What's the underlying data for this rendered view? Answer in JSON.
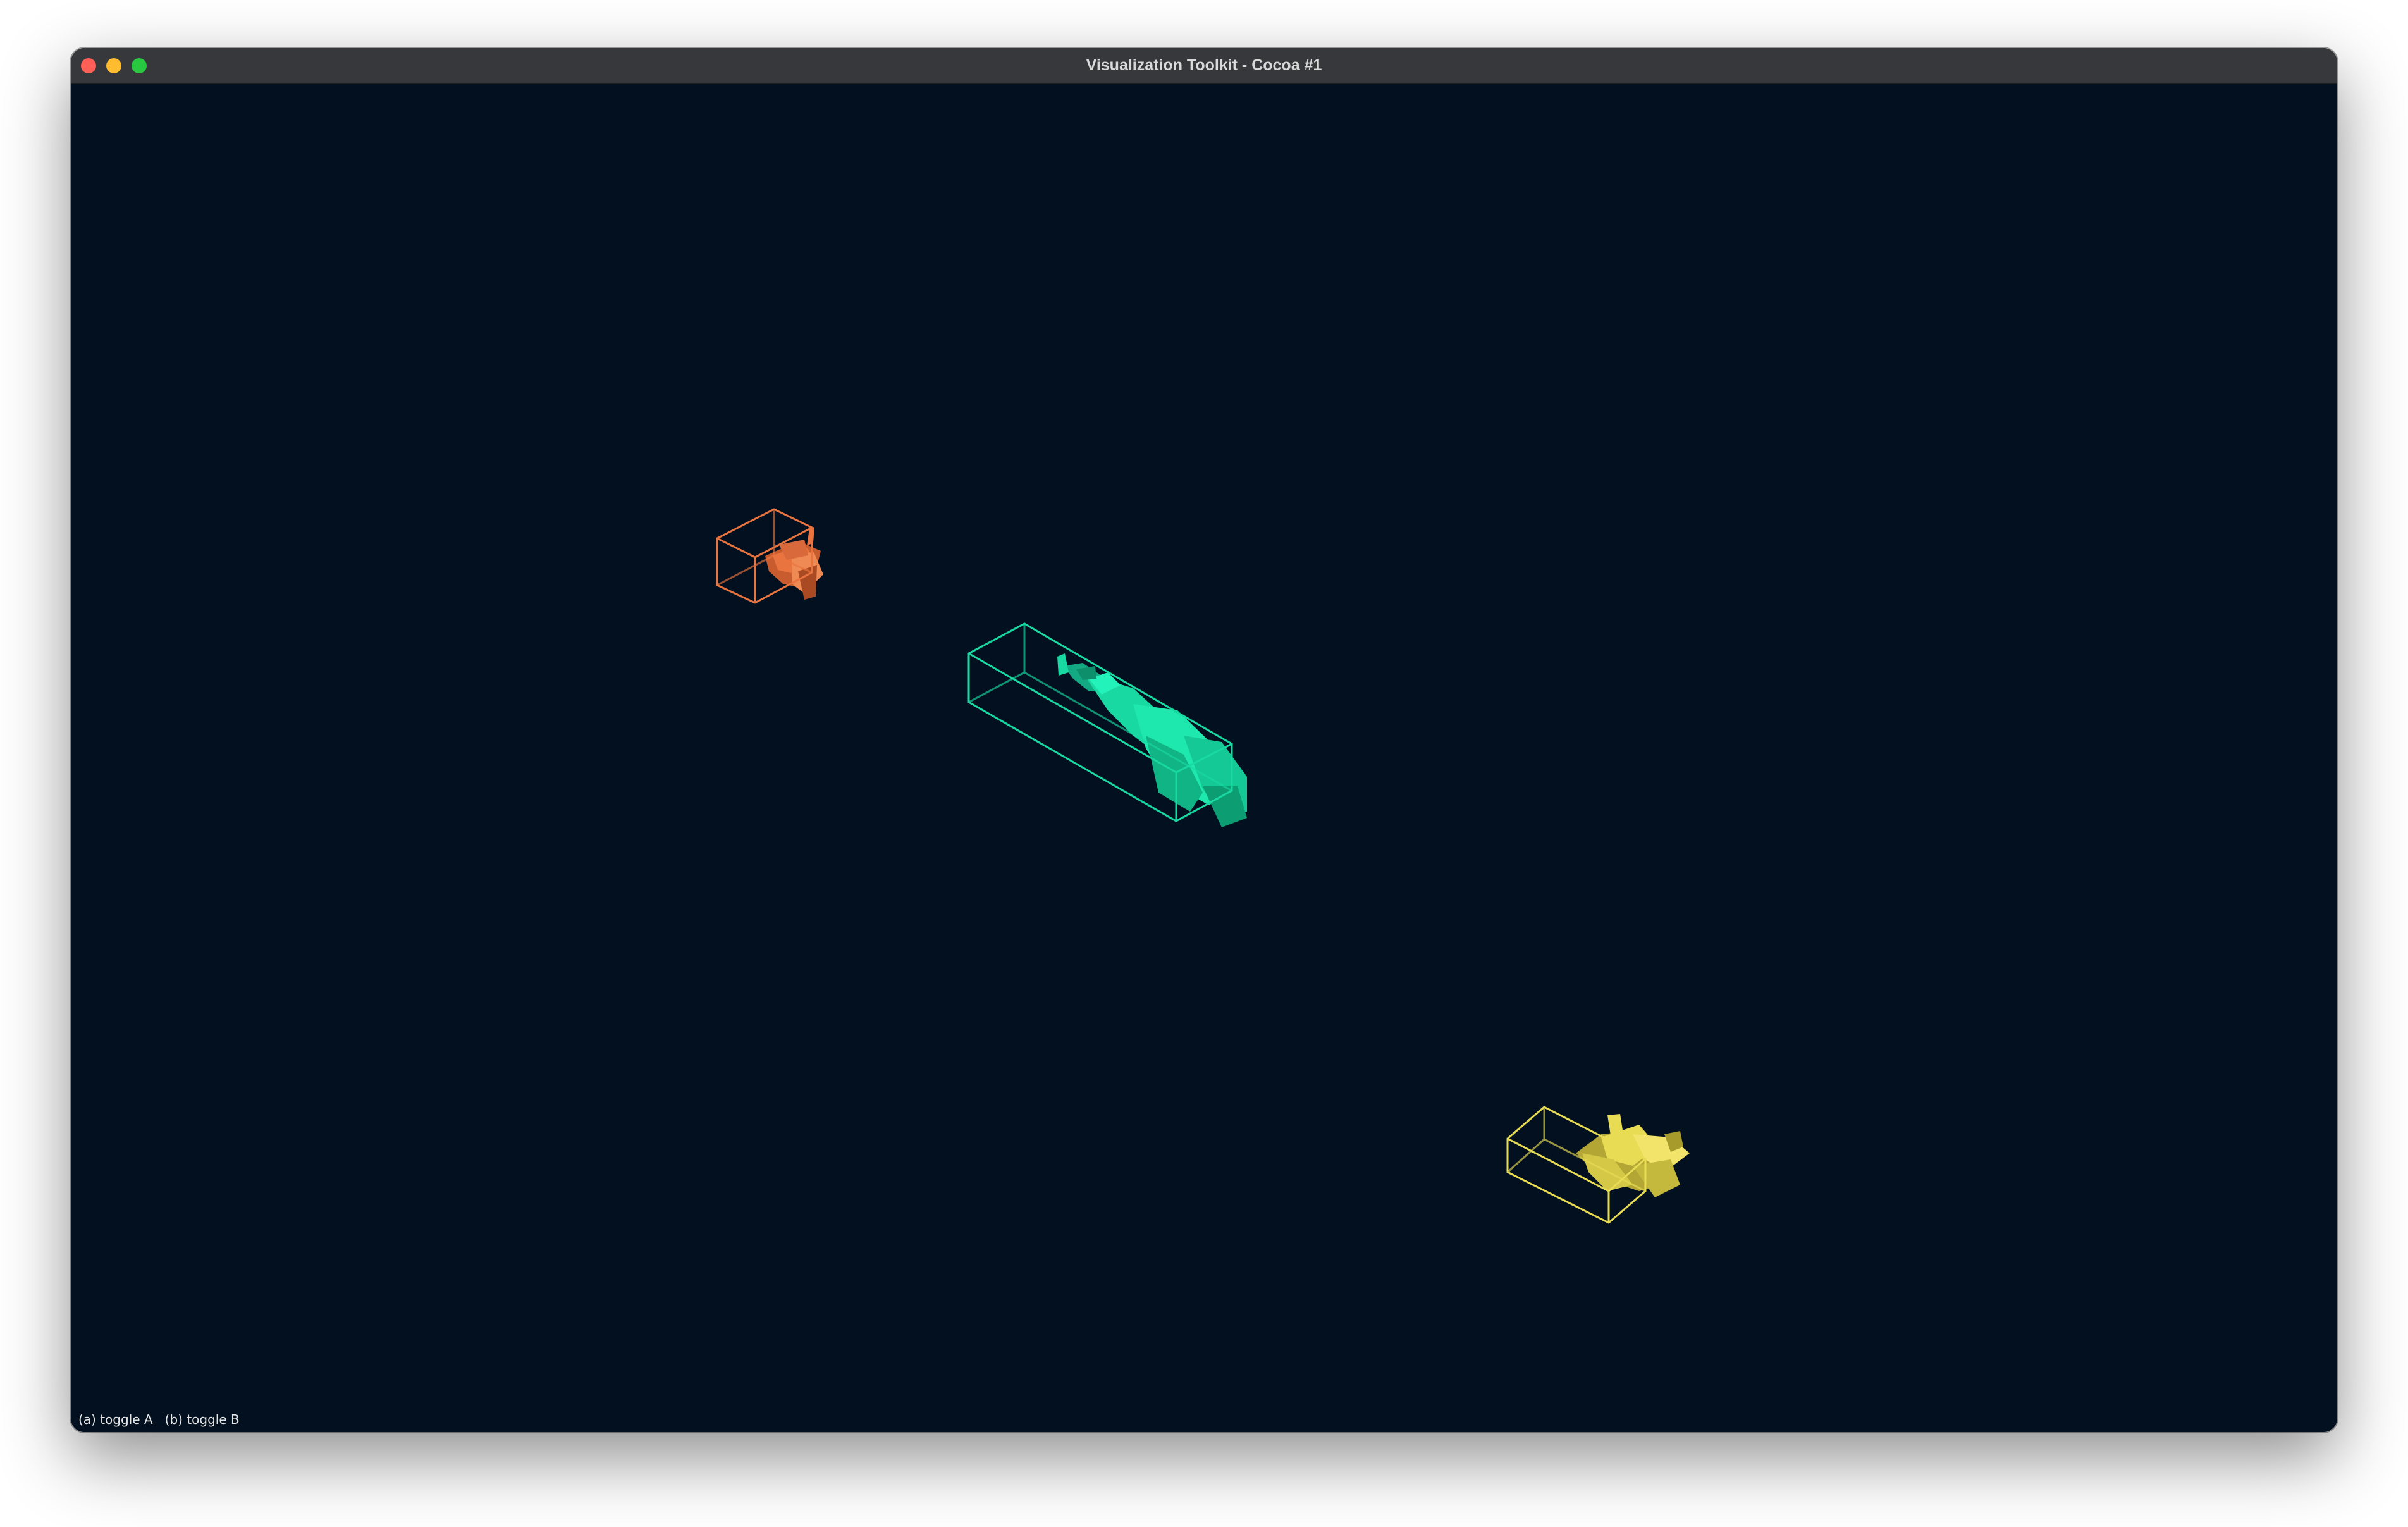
{
  "window": {
    "title": "Visualization Toolkit - Cocoa #1"
  },
  "overlay": {
    "hint_text": "(a) toggle A   (b) toggle B"
  },
  "scene": {
    "background_color": "#02101f",
    "objects": [
      {
        "name": "orange-mesh",
        "color": "#e9743f"
      },
      {
        "name": "teal-mesh",
        "color": "#19d9a3"
      },
      {
        "name": "yellow-mesh",
        "color": "#e8dc54"
      }
    ]
  }
}
